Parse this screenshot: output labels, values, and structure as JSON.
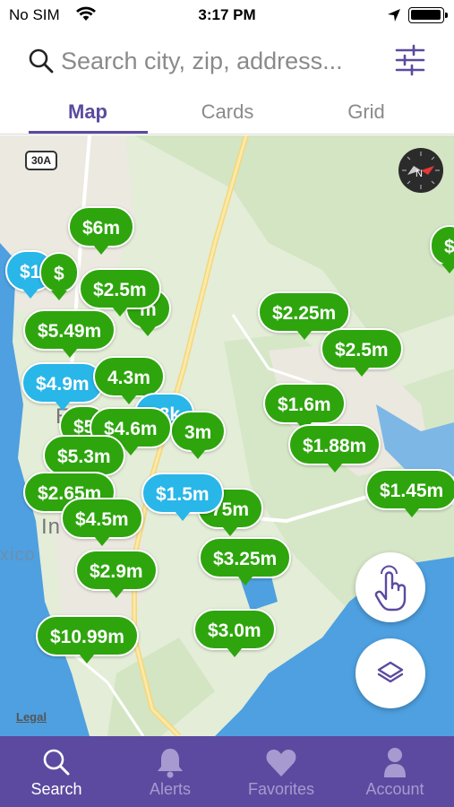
{
  "status_bar": {
    "carrier": "No SIM",
    "time": "3:17 PM"
  },
  "search": {
    "placeholder": "Search city, zip, address..."
  },
  "tabs": [
    {
      "label": "Map",
      "active": true
    },
    {
      "label": "Cards",
      "active": false
    },
    {
      "label": "Grid",
      "active": false
    }
  ],
  "map": {
    "road_shield": "30A",
    "water_label": "xico",
    "town_label": "In",
    "town_label_2": "E",
    "legal": "Legal",
    "pins": [
      {
        "label": "$6m",
        "color": "green"
      },
      {
        "label": "$1",
        "color": "blue"
      },
      {
        "label": "$",
        "color": "green"
      },
      {
        "label": "$2.5m",
        "color": "green"
      },
      {
        "label": "m",
        "color": "green"
      },
      {
        "label": "$5.49m",
        "color": "green"
      },
      {
        "label": "$4.9m",
        "color": "blue"
      },
      {
        "label": "4.3m",
        "color": "green"
      },
      {
        "label": "88k",
        "color": "blue"
      },
      {
        "label": "$4.6m",
        "color": "green"
      },
      {
        "label": "3m",
        "color": "green"
      },
      {
        "label": "$5",
        "color": "green"
      },
      {
        "label": "$5.3m",
        "color": "green"
      },
      {
        "label": "$2.65m",
        "color": "green"
      },
      {
        "label": "$1.5m",
        "color": "blue"
      },
      {
        "label": "75m",
        "color": "green"
      },
      {
        "label": "$4.5m",
        "color": "green"
      },
      {
        "label": "$2.9m",
        "color": "green"
      },
      {
        "label": "$10.99m",
        "color": "green"
      },
      {
        "label": "$2.25m",
        "color": "green"
      },
      {
        "label": "$2.5m",
        "color": "green"
      },
      {
        "label": "$1.6m",
        "color": "green"
      },
      {
        "label": "$1.88m",
        "color": "green"
      },
      {
        "label": "$1.45m",
        "color": "green"
      },
      {
        "label": "$3.25m",
        "color": "green"
      },
      {
        "label": "$3.0m",
        "color": "green"
      },
      {
        "label": "$",
        "color": "green"
      }
    ]
  },
  "bottom_nav": [
    {
      "label": "Search",
      "icon": "search-icon",
      "active": true
    },
    {
      "label": "Alerts",
      "icon": "bell-icon",
      "active": false
    },
    {
      "label": "Favorites",
      "icon": "heart-icon",
      "active": false
    },
    {
      "label": "Account",
      "icon": "person-icon",
      "active": false
    }
  ],
  "colors": {
    "brand_purple": "#5c4aa0",
    "pin_green": "#2ea50d",
    "pin_blue": "#29b6e8"
  }
}
